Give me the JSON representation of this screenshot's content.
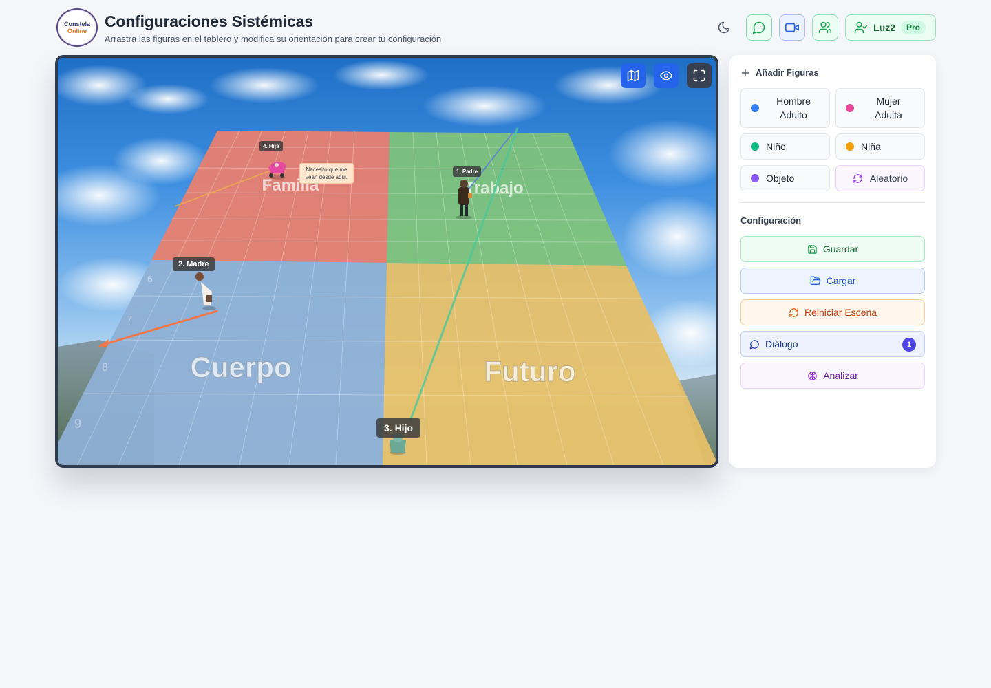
{
  "header": {
    "logo_line1": "Constela",
    "logo_line2": "Online",
    "title": "Configuraciones Sistémicas",
    "subtitle": "Arrastra las figuras en el tablero y modifica su orientación para crear tu configuración",
    "user_name": "Luz2",
    "plan_badge": "Pro",
    "icons": [
      "moon-icon",
      "chat-icon",
      "video-icon",
      "users-icon",
      "user-check-icon"
    ]
  },
  "scene": {
    "zones": {
      "family": "Familia",
      "work": "Trabajo",
      "body": "Cuerpo",
      "future": "Futuro"
    },
    "zone_colors": {
      "family": "#ea7e6c",
      "work": "#7fc77a",
      "body": "#8fb1d6",
      "future": "#e6c16a"
    },
    "row_numbers": [
      "6",
      "7",
      "8",
      "9"
    ],
    "figures": [
      {
        "label": "4. Hija",
        "color": "#ec4899"
      },
      {
        "label": "1. Padre",
        "color": "#3b82f6"
      },
      {
        "label": "2. Madre",
        "color": "#ef4444"
      },
      {
        "label": "3. Hijo",
        "color": "#10b981"
      }
    ],
    "speech_bubble_line1": "Necesito que me",
    "speech_bubble_line2": "vean desde aqui.",
    "tools": [
      "map-icon",
      "eye-icon",
      "fullscreen-icon"
    ]
  },
  "panel": {
    "add_title": "Añadir Figuras",
    "figure_buttons": [
      {
        "label_line1": "Hombre",
        "label_line2": "Adulto",
        "color": "#3b82f6"
      },
      {
        "label_line1": "Mujer",
        "label_line2": "Adulta",
        "color": "#ec4899"
      },
      {
        "label": "Niño",
        "color": "#10b981"
      },
      {
        "label": "Niña",
        "color": "#f59e0b"
      },
      {
        "label": "Objeto",
        "color": "#8b5cf6"
      },
      {
        "label": "Aleatorio",
        "icon": "shuffle-icon"
      }
    ],
    "config_title": "Configuración",
    "save_label": "Guardar",
    "load_label": "Cargar",
    "reset_label": "Reiniciar Escena",
    "dialog_label": "Diálogo",
    "dialog_count": "1",
    "analyze_label": "Analizar"
  }
}
